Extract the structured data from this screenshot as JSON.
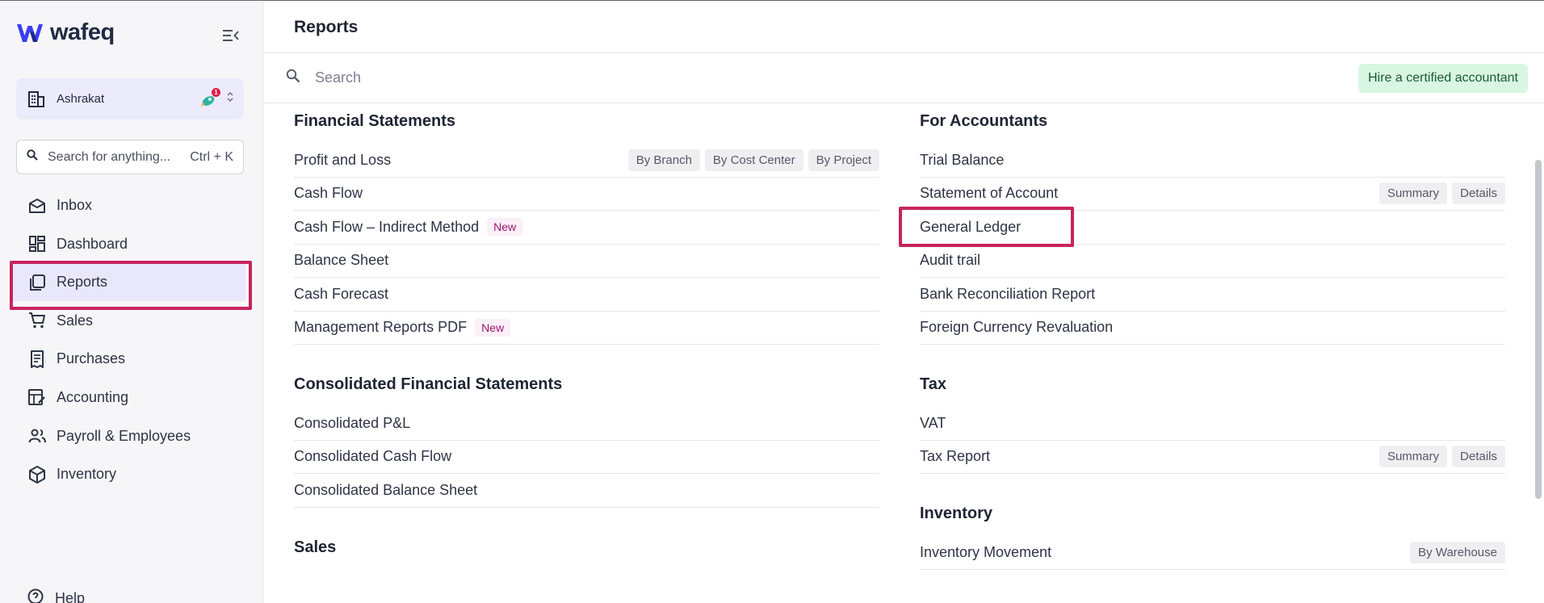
{
  "app": {
    "logo_text": "wafeq",
    "brand_color": "#3b3ff0"
  },
  "sidebar": {
    "org_name": "Ashrakat",
    "org_badge_count": "1",
    "search": {
      "placeholder": "Search for anything...",
      "shortcut": "Ctrl + K"
    },
    "items": [
      {
        "label": "Inbox",
        "icon": "inbox-icon"
      },
      {
        "label": "Dashboard",
        "icon": "dashboard-icon"
      },
      {
        "label": "Reports",
        "icon": "reports-icon",
        "active": true
      },
      {
        "label": "Sales",
        "icon": "cart-icon"
      },
      {
        "label": "Purchases",
        "icon": "receipt-icon"
      },
      {
        "label": "Accounting",
        "icon": "ledger-icon"
      },
      {
        "label": "Payroll & Employees",
        "icon": "people-icon"
      },
      {
        "label": "Inventory",
        "icon": "box-icon"
      }
    ],
    "help_label": "Help"
  },
  "header": {
    "title": "Reports"
  },
  "toolbar": {
    "search_placeholder": "Search",
    "hire_label": "Hire a certified accountant"
  },
  "left_column": [
    {
      "title": "Financial Statements",
      "rows": [
        {
          "name": "Profit and Loss",
          "tags": [
            "By Branch",
            "By Cost Center",
            "By Project"
          ]
        },
        {
          "name": "Cash Flow"
        },
        {
          "name": "Cash Flow – Indirect Method",
          "badge": "New"
        },
        {
          "name": "Balance Sheet"
        },
        {
          "name": "Cash Forecast"
        },
        {
          "name": "Management Reports PDF",
          "badge": "New"
        }
      ]
    },
    {
      "title": "Consolidated Financial Statements",
      "rows": [
        {
          "name": "Consolidated P&L"
        },
        {
          "name": "Consolidated Cash Flow"
        },
        {
          "name": "Consolidated Balance Sheet"
        }
      ]
    },
    {
      "title": "Sales",
      "rows": []
    }
  ],
  "right_column": [
    {
      "title": "For Accountants",
      "rows": [
        {
          "name": "Trial Balance"
        },
        {
          "name": "Statement of Account",
          "tags": [
            "Summary",
            "Details"
          ]
        },
        {
          "name": "General Ledger",
          "highlighted": true
        },
        {
          "name": "Audit trail"
        },
        {
          "name": "Bank Reconciliation Report"
        },
        {
          "name": "Foreign Currency Revaluation"
        }
      ]
    },
    {
      "title": "Tax",
      "rows": [
        {
          "name": "VAT"
        },
        {
          "name": "Tax Report",
          "tags": [
            "Summary",
            "Details"
          ]
        }
      ]
    },
    {
      "title": "Inventory",
      "rows": [
        {
          "name": "Inventory Movement",
          "tags": [
            "By Warehouse"
          ]
        }
      ]
    }
  ],
  "colors": {
    "highlight": "#c8245c",
    "active_bg": "#e9e7fb",
    "new_badge_text": "#9b1670",
    "hire_bg": "#d9f6e2"
  }
}
